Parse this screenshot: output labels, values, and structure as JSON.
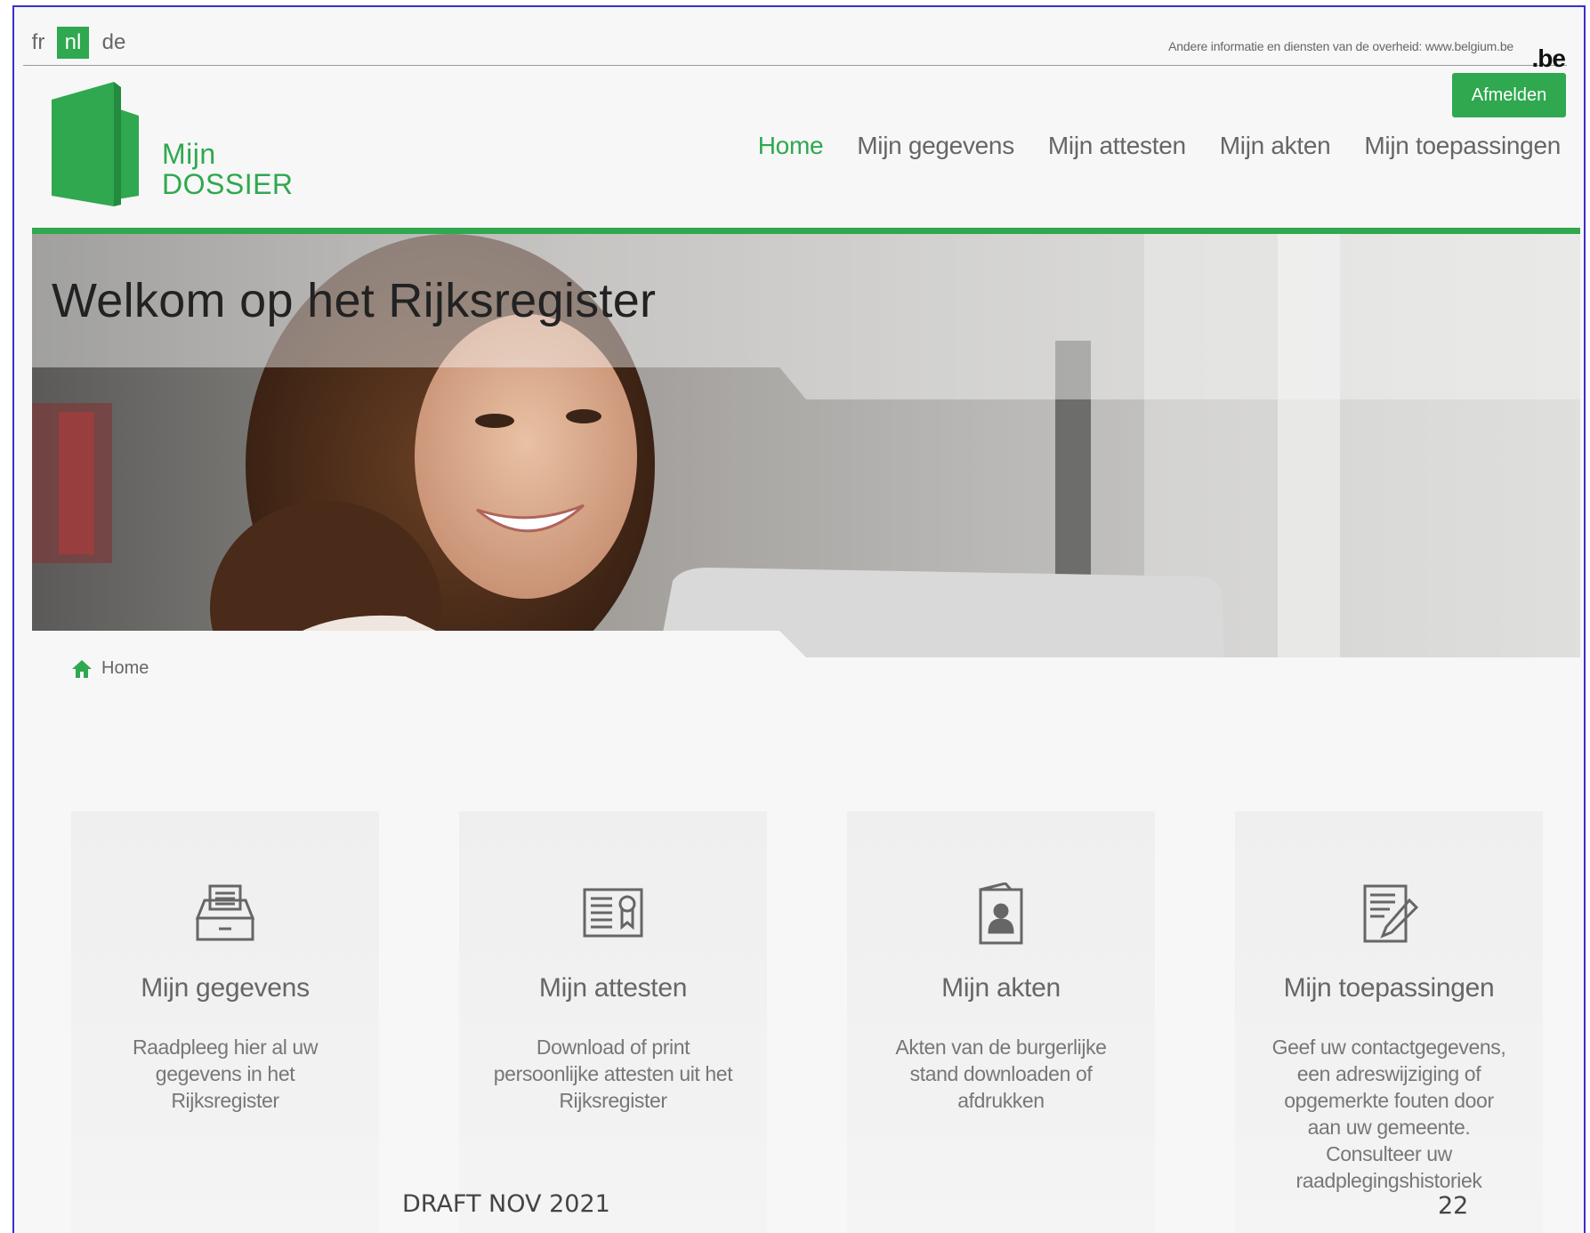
{
  "languages": {
    "fr": "fr",
    "nl": "nl",
    "de": "de",
    "active": "nl"
  },
  "gov_info": "Andere informatie en diensten van de overheid: www.belgium.be",
  "be_logo": ".be",
  "header": {
    "logout_label": "Afmelden",
    "logo_line1": "Mijn",
    "logo_line2": "DOSSIER"
  },
  "nav": {
    "items": [
      {
        "label": "Home",
        "active": true
      },
      {
        "label": "Mijn gegevens",
        "active": false
      },
      {
        "label": "Mijn attesten",
        "active": false
      },
      {
        "label": "Mijn akten",
        "active": false
      },
      {
        "label": "Mijn toepassingen",
        "active": false
      }
    ]
  },
  "hero": {
    "title": "Welkom op het Rijksregister"
  },
  "breadcrumb": {
    "home": "Home"
  },
  "cards": [
    {
      "icon": "archive-tray-icon",
      "title": "Mijn gegevens",
      "description": "Raadpleeg hier al uw gegevens in het Rijksregister"
    },
    {
      "icon": "certificate-icon",
      "title": "Mijn attesten",
      "description": "Download of print persoonlijke attesten uit het Rijksregister"
    },
    {
      "icon": "person-document-icon",
      "title": "Mijn akten",
      "description": "Akten van de burgerlijke stand downloaden of afdrukken"
    },
    {
      "icon": "edit-document-icon",
      "title": "Mijn toepassingen",
      "description": "Geef uw contactgegevens, een adreswijziging of opgemerkte fouten door aan uw gemeente. Consulteer uw raadplegingshistoriek"
    }
  ],
  "footer": {
    "draft": "DRAFT NOV 2021",
    "page_number": "22"
  },
  "colors": {
    "accent": "#2fa84f",
    "frame_border": "#3b2fc9"
  }
}
